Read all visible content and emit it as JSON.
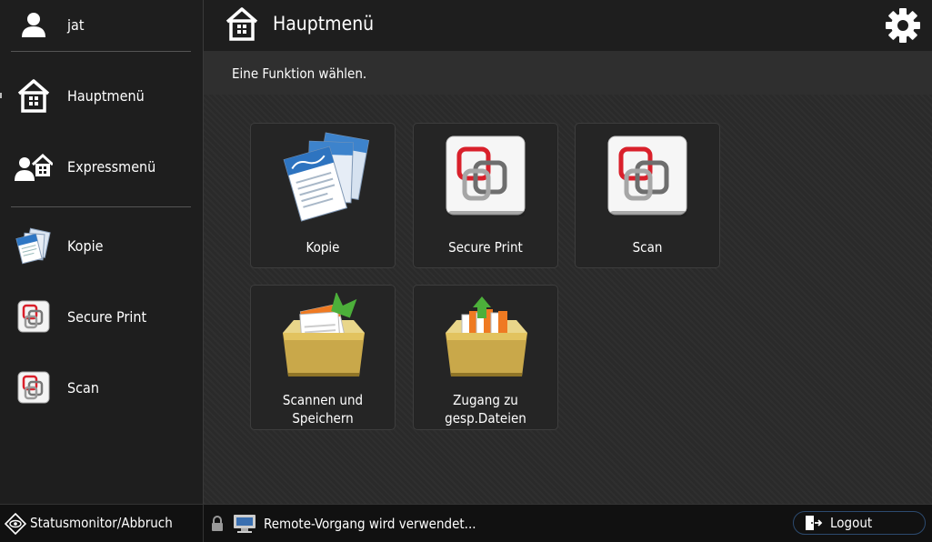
{
  "sidebar": {
    "user": "jat",
    "items": [
      {
        "label": "Hauptmenü",
        "icon": "home-icon"
      },
      {
        "label": "Expressmenü",
        "icon": "express-menu-icon"
      },
      {
        "label": "Kopie",
        "icon": "copy-icon"
      },
      {
        "label": "Secure Print",
        "icon": "secure-print-icon"
      },
      {
        "label": "Scan",
        "icon": "scan-icon"
      }
    ]
  },
  "header": {
    "title": "Hauptmenü",
    "subtitle": "Eine Funktion wählen."
  },
  "tiles": [
    {
      "label": "Kopie",
      "icon": "copy-icon"
    },
    {
      "label": "Secure Print",
      "icon": "secure-print-icon"
    },
    {
      "label": "Scan",
      "icon": "scan-icon"
    },
    {
      "label_line1": "Scannen und",
      "label_line2": "Speichern",
      "icon": "scan-and-store-icon"
    },
    {
      "label_line1": "Zugang zu",
      "label_line2": "gesp.Dateien",
      "icon": "stored-files-icon"
    }
  ],
  "statusbar": {
    "status_monitor": "Statusmonitor/Abbruch",
    "remote_message": "Remote-Vorgang wird verwendet...",
    "logout": "Logout"
  },
  "colors": {
    "background": "#2b2b2b",
    "sidebar": "#1e1e1e",
    "statusbar": "#111111",
    "secure_print_red": "#d9202b",
    "folder_gold": "#c9a84a",
    "arrow_green": "#4caf3a",
    "logout_border": "#2c4a6e"
  }
}
